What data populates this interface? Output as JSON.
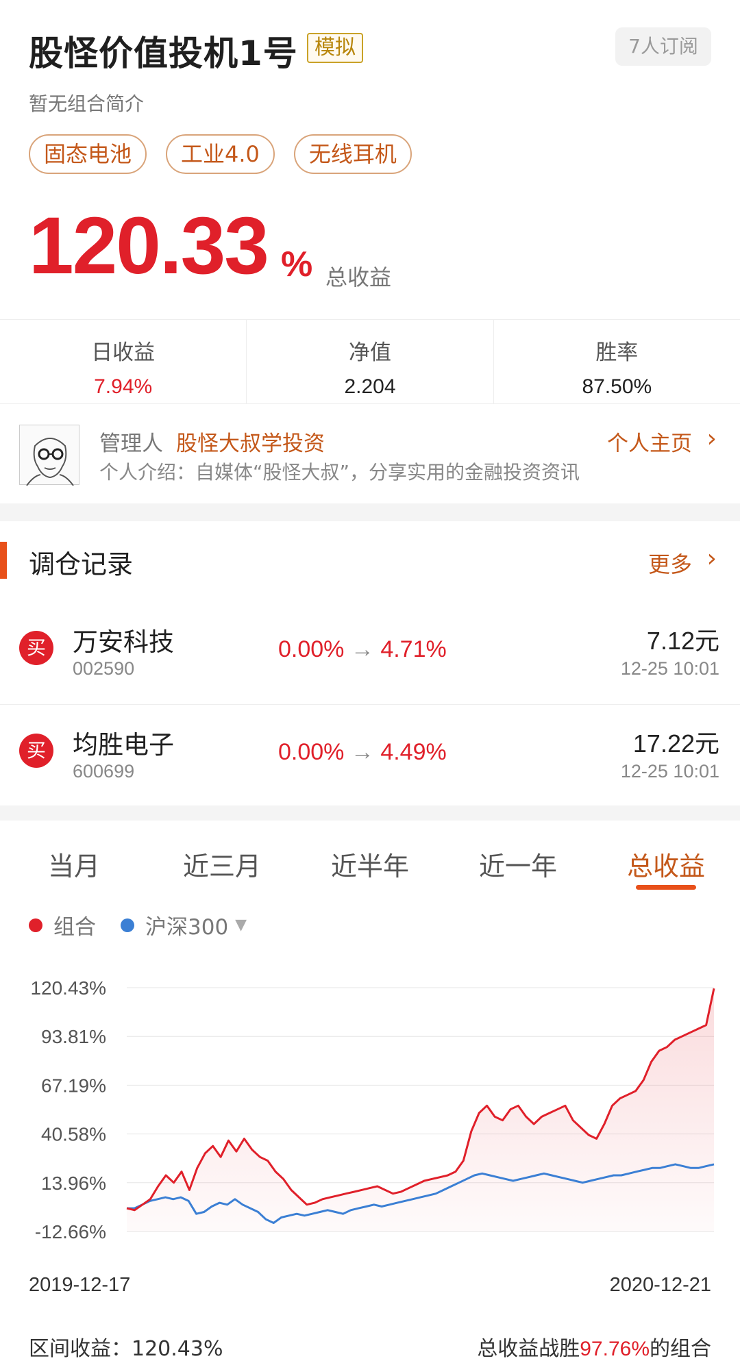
{
  "portfolio": {
    "title": "股怪价值投机1号",
    "sim_badge": "模拟",
    "subscribers": "7人订阅",
    "intro": "暂无组合简介",
    "tags": [
      "固态电池",
      "工业4.0",
      "无线耳机"
    ],
    "total_return": "120.33",
    "total_return_unit": "%",
    "total_return_label": "总收益"
  },
  "stats": {
    "daily_label": "日收益",
    "daily_value": "7.94%",
    "nav_label": "净值",
    "nav_value": "2.204",
    "winrate_label": "胜率",
    "winrate_value": "87.50%"
  },
  "manager": {
    "label": "管理人",
    "name": "股怪大叔学投资",
    "bio": "个人介绍：自媒体“股怪大叔”，分享实用的金融投资资讯",
    "homepage": "个人主页"
  },
  "trades": {
    "title": "调仓记录",
    "more": "更多",
    "badge": "买",
    "arrow": "→",
    "rows": [
      {
        "name": "万安科技",
        "code": "002590",
        "from": "0.00%",
        "to": "4.71%",
        "price": "7.12元",
        "time": "12-25  10:01"
      },
      {
        "name": "均胜电子",
        "code": "600699",
        "from": "0.00%",
        "to": "4.49%",
        "price": "17.22元",
        "time": "12-25  10:01"
      }
    ]
  },
  "tabs": [
    "当月",
    "近三月",
    "近半年",
    "近一年",
    "总收益"
  ],
  "active_tab": 4,
  "legend": {
    "portfolio": "组合",
    "benchmark": "沪深300"
  },
  "colors": {
    "portfolio": "#e0202a",
    "benchmark": "#3b7fd4",
    "accent": "#c4581a"
  },
  "footer": {
    "range_label": "区间收益：",
    "range_value": "120.43%",
    "beat_prefix": "总收益战胜",
    "beat_value": "97.76%",
    "beat_suffix": "的组合"
  },
  "chart_data": {
    "type": "line",
    "yticks": [
      "120.43%",
      "93.81%",
      "67.19%",
      "40.58%",
      "13.96%",
      "-12.66%"
    ],
    "ylim": [
      -12.66,
      120.43
    ],
    "xlabels": [
      "2019-12-17",
      "2020-12-21"
    ],
    "series": [
      {
        "name": "组合",
        "color": "#e0202a",
        "values": [
          0,
          -1,
          2,
          5,
          12,
          18,
          14,
          20,
          10,
          22,
          30,
          34,
          28,
          37,
          31,
          38,
          32,
          28,
          26,
          20,
          16,
          10,
          6,
          2,
          3,
          5,
          6,
          7,
          8,
          9,
          10,
          11,
          12,
          10,
          8,
          9,
          11,
          13,
          15,
          16,
          17,
          18,
          20,
          26,
          42,
          52,
          56,
          50,
          48,
          54,
          56,
          50,
          46,
          50,
          52,
          54,
          56,
          48,
          44,
          40,
          38,
          46,
          56,
          60,
          62,
          64,
          70,
          80,
          86,
          88,
          92,
          94,
          96,
          98,
          100,
          120
        ]
      },
      {
        "name": "沪深300",
        "color": "#3b7fd4",
        "values": [
          0,
          0,
          2,
          4,
          5,
          6,
          5,
          6,
          4,
          -3,
          -2,
          1,
          3,
          2,
          5,
          2,
          0,
          -2,
          -6,
          -8,
          -5,
          -4,
          -3,
          -4,
          -3,
          -2,
          -1,
          -2,
          -3,
          -1,
          0,
          1,
          2,
          1,
          2,
          3,
          4,
          5,
          6,
          7,
          8,
          10,
          12,
          14,
          16,
          18,
          19,
          18,
          17,
          16,
          15,
          16,
          17,
          18,
          19,
          18,
          17,
          16,
          15,
          14,
          15,
          16,
          17,
          18,
          18,
          19,
          20,
          21,
          22,
          22,
          23,
          24,
          23,
          22,
          22,
          23,
          24
        ]
      }
    ]
  }
}
